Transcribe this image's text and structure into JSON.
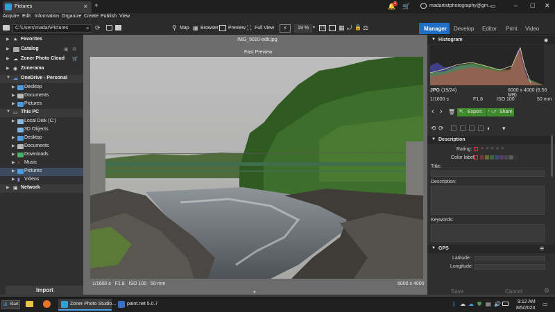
{
  "window": {
    "tab_title": "Pictures",
    "add_tab": "+",
    "account": "madartistphotography@gm...",
    "notif_count": "2"
  },
  "menu": [
    "Acquire",
    "Edit",
    "Information",
    "Organize",
    "Create",
    "Publish",
    "View"
  ],
  "path": "C:\\Users\\madar\\Pictures",
  "toolbar": {
    "map": "Map",
    "browser": "Browser",
    "preview": "Preview",
    "full_view": "Full View",
    "zoom": "19 %"
  },
  "modules": [
    "Manager",
    "Develop",
    "Editor",
    "Print",
    "Video"
  ],
  "sidebar": {
    "items": [
      {
        "label": "Favorites",
        "level": 0,
        "header": true
      },
      {
        "label": "Catalog",
        "level": 0,
        "header": true
      },
      {
        "label": "Zoner Photo Cloud",
        "level": 0,
        "header": true
      },
      {
        "label": "Zonerama",
        "level": 0,
        "header": true
      },
      {
        "label": "OneDrive - Personal",
        "level": 0,
        "header": true
      },
      {
        "label": "Desktop",
        "level": 1
      },
      {
        "label": "Documents",
        "level": 1
      },
      {
        "label": "Pictures",
        "level": 1
      },
      {
        "label": "This PC",
        "level": 0,
        "header": true
      },
      {
        "label": "Local Disk (C:)",
        "level": 1
      },
      {
        "label": "3D Objects",
        "level": 1
      },
      {
        "label": "Desktop",
        "level": 1
      },
      {
        "label": "Documents",
        "level": 1
      },
      {
        "label": "Downloads",
        "level": 1
      },
      {
        "label": "Music",
        "level": 1
      },
      {
        "label": "Pictures",
        "level": 1,
        "selected": true
      },
      {
        "label": "Videos",
        "level": 1
      },
      {
        "label": "Network",
        "level": 0,
        "header": true
      }
    ],
    "import_label": "Import"
  },
  "viewer": {
    "filename": "IMG_5010-edit.jpg",
    "mode_label": "Fast Preview",
    "exif_left": "1/1600 s   F1.8   ISO 100   50 mm",
    "exif_right": "6000 x 4000"
  },
  "histogram": {
    "title": "Histogram",
    "format": "JPG",
    "index": "(19/24)",
    "dims": "6000 x 4000 (6.56 MB)",
    "shutter": "1/1600 s",
    "aperture": "F1.8",
    "iso": "ISO 100",
    "focal": "50 mm"
  },
  "actions": {
    "export": "Export",
    "share": "Share"
  },
  "description": {
    "title": "Description",
    "rating_label": "Rating:",
    "color_label": "Color label:",
    "title_label": "Title:",
    "desc_label": "Description:",
    "keywords_label": "Keywords:"
  },
  "gps": {
    "title": "GPS",
    "latitude": "Latitude:",
    "longitude": "Longitude:"
  },
  "footer": {
    "save": "Save",
    "cancel": "Cancel"
  },
  "taskbar": {
    "start": "Start",
    "app1": "Zoner Photo Studio...",
    "app2": "paint.net 5.0.7",
    "time": "9:12 AM",
    "date": "8/5/2023"
  },
  "colors": {
    "accent": "#1f6fc6",
    "export_green": "#3f8a2c"
  }
}
